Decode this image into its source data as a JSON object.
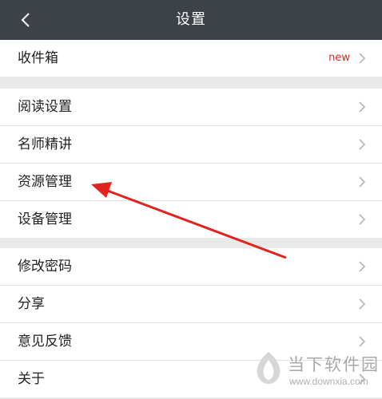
{
  "header": {
    "title": "设置",
    "back_icon": "chevron-left-icon"
  },
  "group1": {
    "inbox": {
      "label": "收件箱",
      "badge": "new"
    }
  },
  "group2": {
    "items": [
      {
        "label": "阅读设置"
      },
      {
        "label": "名师精讲"
      },
      {
        "label": "资源管理"
      },
      {
        "label": "设备管理"
      }
    ]
  },
  "group3": {
    "items": [
      {
        "label": "修改密码"
      },
      {
        "label": "分享"
      },
      {
        "label": "意见反馈"
      },
      {
        "label": "关于"
      }
    ]
  },
  "annotation": {
    "color": "#e0251f"
  },
  "watermark": {
    "name": "当下软件园",
    "url": "www.downxia.com"
  },
  "colors": {
    "header_bg": "#3d4249",
    "badge": "#e0251f",
    "page_bg": "#e9e9e9"
  }
}
